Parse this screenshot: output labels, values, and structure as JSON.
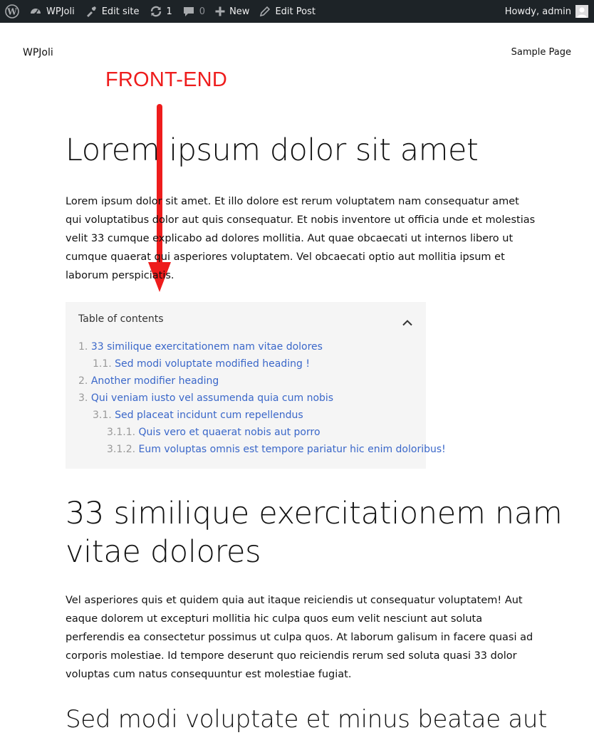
{
  "adminbar": {
    "site_name": "WPJoli",
    "edit_site": "Edit site",
    "updates_count": "1",
    "comments_count": "0",
    "new_label": "New",
    "edit_post": "Edit Post",
    "howdy": "Howdy, admin",
    "icons": [
      "wordpress-logo-icon",
      "dashboard-icon",
      "edit-site-icon",
      "updates-icon",
      "comments-icon",
      "plus-icon",
      "pencil-icon",
      "avatar-icon"
    ]
  },
  "site": {
    "title": "WPJoli",
    "nav": {
      "sample_page": "Sample Page"
    }
  },
  "annotation": {
    "text": "FRONT-END",
    "color": "#ee1c1c"
  },
  "post": {
    "title": "Lorem ipsum dolor sit amet",
    "intro": "Lorem ipsum dolor sit amet. Et illo dolore est rerum voluptatem nam consequatur amet qui voluptatibus dolor aut quis consequatur. Et nobis inventore ut officia unde et molestias velit 33 cumque explicabo ad dolores mollitia. Aut quae obcaecati ut internos libero ut cumque quaerat qui asperiores voluptatem. Vel obcaecati optio aut mollitia ipsum et laborum perspiciatis.",
    "h2": "33 similique exercitationem nam vitae dolores",
    "para2": "Vel asperiores quis et quidem quia aut itaque reiciendis ut consequatur voluptatem! Aut eaque dolorem ut excepturi mollitia hic culpa quos eum velit nesciunt aut soluta perferendis ea consectetur possimus ut culpa quos. At laborum galisum in facere quasi ad corporis molestiae. Id tempore deserunt quo reiciendis rerum sed soluta quasi 33 dolor voluptas cum natus consequuntur est molestiae fugiat.",
    "h3": "Sed modi voluptate et minus beatae aut"
  },
  "toc": {
    "title": "Table of contents",
    "link_color": "#3a67c9",
    "items": [
      {
        "num": "1.",
        "label": "33 similique exercitationem nam vitae dolores"
      },
      {
        "num": "1.1.",
        "label": "Sed modi voluptate modified heading !"
      },
      {
        "num": "2.",
        "label": "Another modifier heading"
      },
      {
        "num": "3.",
        "label": "Qui veniam iusto vel assumenda quia cum nobis"
      },
      {
        "num": "3.1.",
        "label": "Sed placeat incidunt cum repellendus"
      },
      {
        "num": "3.1.1.",
        "label": "Quis vero et quaerat nobis aut porro"
      },
      {
        "num": "3.1.2.",
        "label": "Eum voluptas omnis est tempore pariatur hic enim doloribus!"
      }
    ]
  }
}
